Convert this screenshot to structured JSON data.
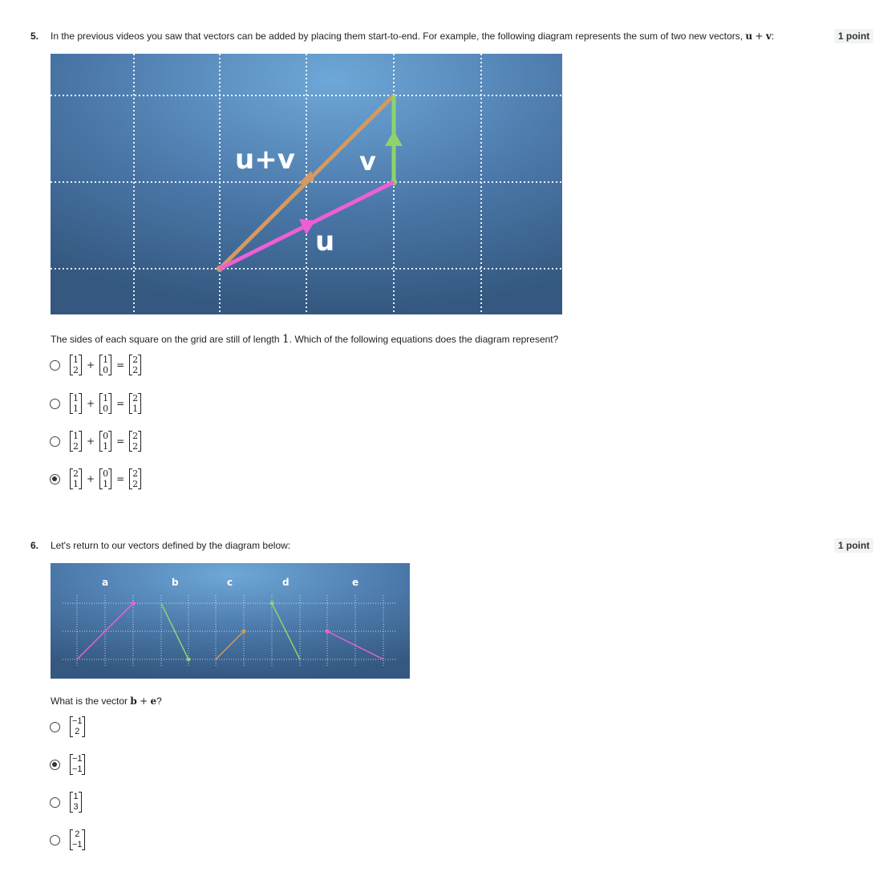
{
  "q5": {
    "number": "5.",
    "intro": "In the previous videos you saw that vectors can be added by placing them start-to-end. For example, the following diagram represents the sum of two new vectors,",
    "expr": [
      "u",
      "+",
      "v"
    ],
    "points": "1 point",
    "diagram_labels": {
      "uv": "u+v",
      "v": "v",
      "u": "u"
    },
    "question": "The sides of each square on the grid are still of length",
    "question_num": "1",
    "question_end": ". Which of the following equations does the diagram represent?",
    "options": [
      {
        "a": [
          "1",
          "2"
        ],
        "b": [
          "1",
          "0"
        ],
        "c": [
          "2",
          "2"
        ],
        "selected": false
      },
      {
        "a": [
          "1",
          "1"
        ],
        "b": [
          "1",
          "0"
        ],
        "c": [
          "2",
          "1"
        ],
        "selected": false
      },
      {
        "a": [
          "1",
          "2"
        ],
        "b": [
          "0",
          "1"
        ],
        "c": [
          "2",
          "2"
        ],
        "selected": false
      },
      {
        "a": [
          "2",
          "1"
        ],
        "b": [
          "0",
          "1"
        ],
        "c": [
          "2",
          "2"
        ],
        "selected": true
      }
    ],
    "plus": "+",
    "equals": "="
  },
  "q6": {
    "number": "6.",
    "intro": "Let's return to our vectors defined by the diagram below:",
    "points": "1 point",
    "diagram_labels": [
      "a",
      "b",
      "c",
      "d",
      "e"
    ],
    "question_pre": "What is the vector",
    "question_expr": [
      "b",
      "+",
      "e"
    ],
    "question_end": "?",
    "options": [
      {
        "v": [
          "−1",
          "2"
        ],
        "selected": false
      },
      {
        "v": [
          "−1",
          "−1"
        ],
        "selected": true
      },
      {
        "v": [
          "1",
          "3"
        ],
        "selected": false
      },
      {
        "v": [
          "2",
          "−1"
        ],
        "selected": false
      }
    ]
  },
  "colors": {
    "panel": "#3f6a98",
    "orange": "#d39a63",
    "green": "#8fd36a",
    "pink": "#ee5fd6"
  }
}
